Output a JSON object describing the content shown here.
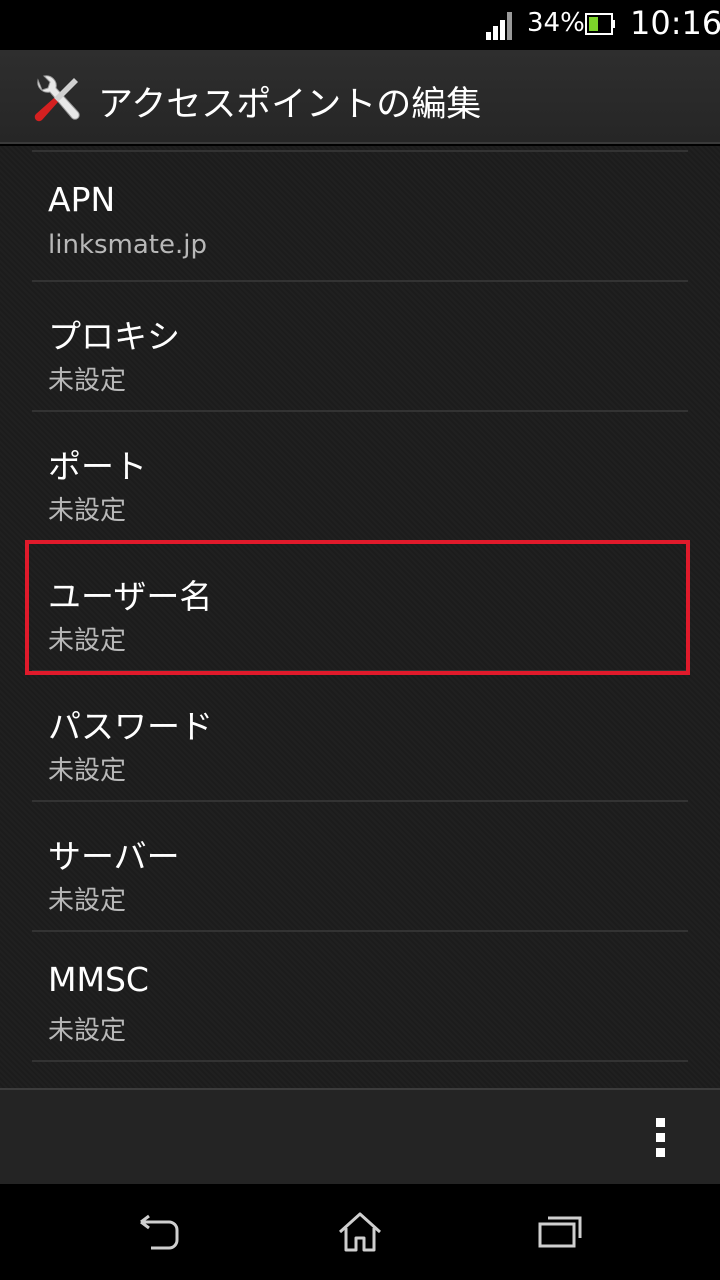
{
  "status_bar": {
    "battery_percent": "34%",
    "time": "10:16",
    "icons": [
      "signal-icon",
      "battery-icon"
    ]
  },
  "action_bar": {
    "title": "アクセスポイントの編集",
    "icon": "settings-tools-icon"
  },
  "settings": [
    {
      "title": "APN",
      "summary": "linksmate.jp"
    },
    {
      "title": "プロキシ",
      "summary": "未設定"
    },
    {
      "title": "ポート",
      "summary": "未設定"
    },
    {
      "title": "ユーザー名",
      "summary": "未設定"
    },
    {
      "title": "パスワード",
      "summary": "未設定"
    },
    {
      "title": "サーバー",
      "summary": "未設定"
    },
    {
      "title": "MMSC",
      "summary": "未設定"
    }
  ],
  "highlight": {
    "target": "ユーザー名",
    "color": "#e01a2b"
  },
  "menu_bar": {
    "icon": "overflow-menu-icon"
  },
  "nav_bar": {
    "icons": [
      "back-icon",
      "home-icon",
      "recent-apps-icon"
    ]
  }
}
